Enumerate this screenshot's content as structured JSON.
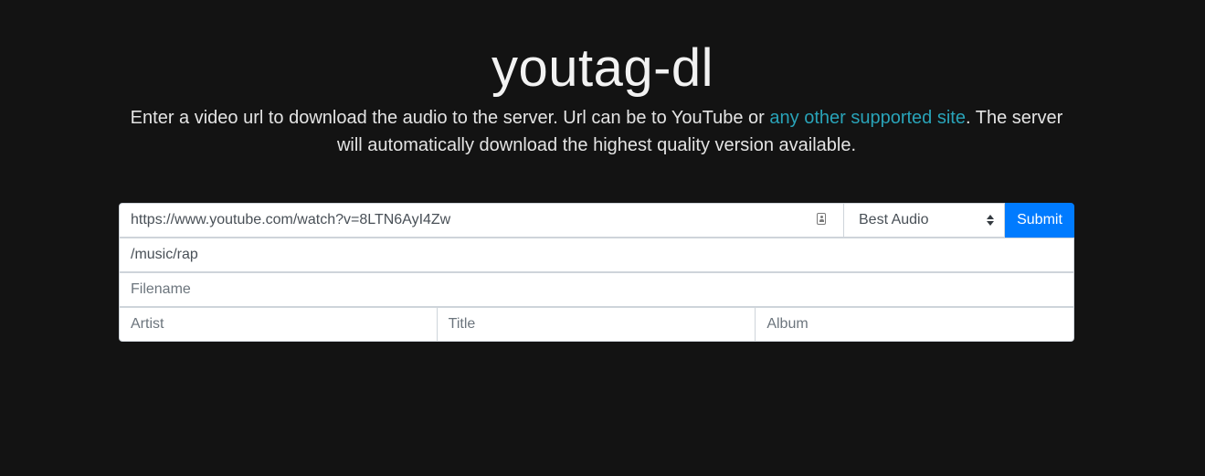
{
  "header": {
    "title": "youtag-dl",
    "lead_before": "Enter a video url to download the audio to the server. Url can be to YouTube or ",
    "lead_link": "any other supported site",
    "lead_after": ". The server will automatically download the highest quality version available."
  },
  "form": {
    "url_value": "https://www.youtube.com/watch?v=8LTN6AyI4Zw",
    "quality_selected": "Best Audio",
    "submit_label": "Submit",
    "path_value": "/music/rap",
    "filename_placeholder": "Filename",
    "artist_placeholder": "Artist",
    "title_placeholder": "Title",
    "album_placeholder": "Album"
  },
  "icons": {
    "url_field_icon": "contact-card-icon",
    "select_arrows": "up-down-arrows-icon"
  },
  "colors": {
    "background": "#131313",
    "link": "#29a3b8",
    "primary": "#007bff"
  }
}
